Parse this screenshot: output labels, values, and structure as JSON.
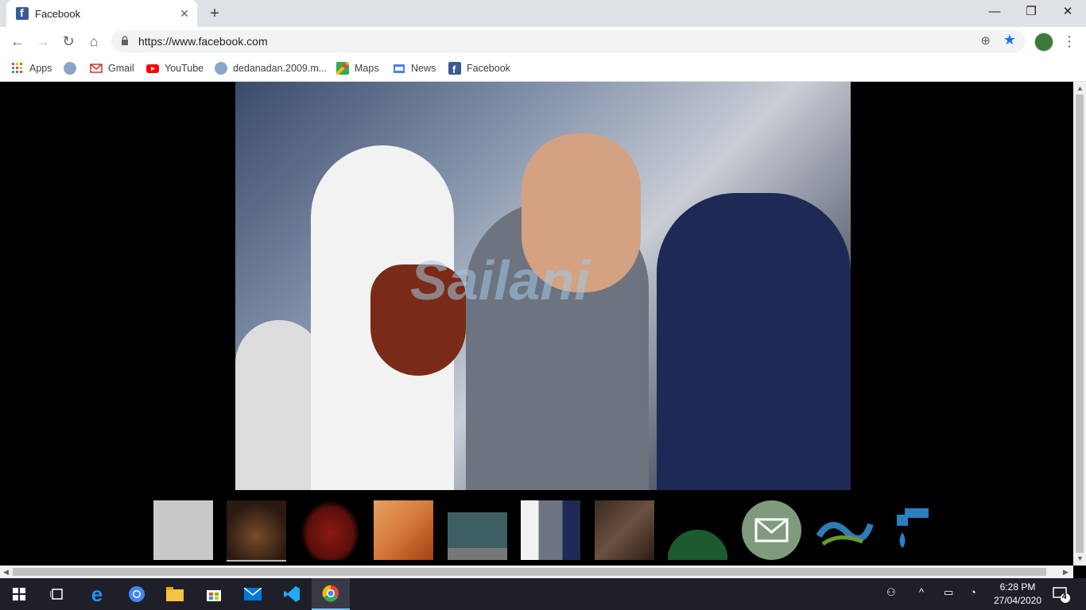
{
  "browser": {
    "tab_title": "Facebook",
    "url": "https://www.facebook.com",
    "new_tab": "+",
    "close_tab": "✕",
    "window_controls": {
      "minimize": "—",
      "maximize": "❐",
      "close": "✕"
    }
  },
  "bookmarks": [
    {
      "label": "Apps",
      "icon": "apps-grid-icon",
      "color": "#ea4335"
    },
    {
      "label": "",
      "icon": "water-drop-icon",
      "color": "#8aa4c8"
    },
    {
      "label": "Gmail",
      "icon": "gmail-icon",
      "color": "#d93025"
    },
    {
      "label": "YouTube",
      "icon": "youtube-icon",
      "color": "#ff0000"
    },
    {
      "label": "dedanadan.2009.m...",
      "icon": "site-icon",
      "color": "#8aa4c8"
    },
    {
      "label": "Maps",
      "icon": "maps-icon",
      "color": "#34a853"
    },
    {
      "label": "News",
      "icon": "news-icon",
      "color": "#4285f4"
    },
    {
      "label": "Facebook",
      "icon": "facebook-icon",
      "color": "#3b5998"
    }
  ],
  "viewer": {
    "watermark": "Sailani",
    "thumbnails": [
      {
        "name": "foundation-logo",
        "color": "#c9c9c9"
      },
      {
        "name": "food-plate",
        "color": "#2a1a10"
      },
      {
        "name": "liver-icon",
        "color": "#8b1a12"
      },
      {
        "name": "orange-group",
        "color": "#d4793a"
      },
      {
        "name": "laptop",
        "color": "#3d5f62"
      },
      {
        "name": "president-photo",
        "color": "#6e7380"
      },
      {
        "name": "meeting-photo",
        "color": "#3a2c22"
      },
      {
        "name": "green-badge",
        "color": "#1d5a2e"
      },
      {
        "name": "envelope",
        "color": "#7f9a7c"
      },
      {
        "name": "urdu-logo",
        "color": "#2f7cb5"
      },
      {
        "name": "water-tap",
        "color": "#2b7fc0"
      }
    ]
  },
  "taskbar": {
    "apps": [
      {
        "name": "start-button",
        "glyph": "⊞"
      },
      {
        "name": "task-view",
        "glyph": "▯"
      },
      {
        "name": "edge",
        "glyph": "e"
      },
      {
        "name": "chrome-icon",
        "glyph": "◉"
      },
      {
        "name": "file-explorer",
        "glyph": "▤"
      },
      {
        "name": "store",
        "glyph": "▦"
      },
      {
        "name": "mail",
        "glyph": "✉"
      },
      {
        "name": "vscode",
        "glyph": "⋈"
      },
      {
        "name": "chrome-active",
        "glyph": "◉"
      }
    ],
    "time": "6:28 PM",
    "date": "27/04/2020",
    "notification_count": "4"
  }
}
